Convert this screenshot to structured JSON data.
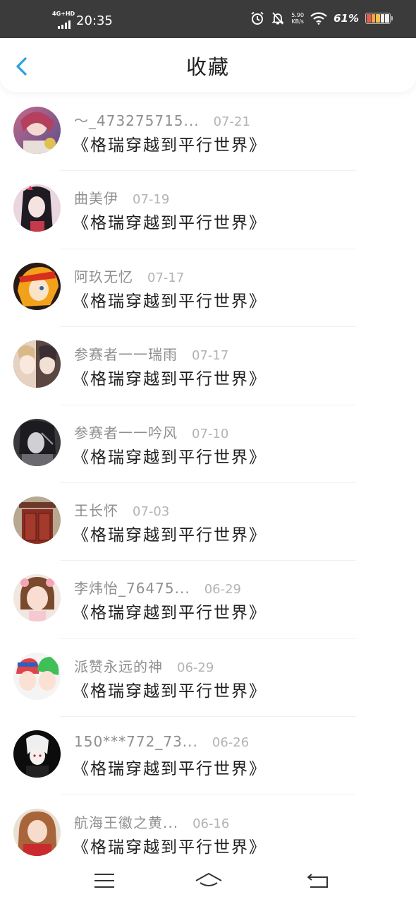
{
  "status_bar": {
    "network_type": "4G+HD",
    "time": "20:35",
    "speed_value": "5.90",
    "speed_unit": "KB/s",
    "battery_percent": "61%",
    "icons": [
      "signal-icon",
      "alarm-icon",
      "notifications-off-icon",
      "wifi-icon",
      "battery-icon"
    ]
  },
  "header": {
    "back_icon": "chevron-left-icon",
    "title": "收藏",
    "accent_color": "#2d9fe0"
  },
  "items": [
    {
      "user": "～_473275715...",
      "date": "07-21",
      "title": "《格瑞穿越到平行世界》",
      "avatar": "anime-avatar-1"
    },
    {
      "user": "曲美伊",
      "date": "07-19",
      "title": "《格瑞穿越到平行世界》",
      "avatar": "anime-avatar-2"
    },
    {
      "user": "阿玖无忆",
      "date": "07-17",
      "title": "《格瑞穿越到平行世界》",
      "avatar": "anime-avatar-3"
    },
    {
      "user": "参赛者一一瑞雨",
      "date": "07-17",
      "title": "《格瑞穿越到平行世界》",
      "avatar": "anime-avatar-4"
    },
    {
      "user": "参赛者一一吟风",
      "date": "07-10",
      "title": "《格瑞穿越到平行世界》",
      "avatar": "anime-avatar-5"
    },
    {
      "user": "王长怀",
      "date": "07-03",
      "title": "《格瑞穿越到平行世界》",
      "avatar": "door-photo-avatar"
    },
    {
      "user": "李炜怡_76475...",
      "date": "06-29",
      "title": "《格瑞穿越到平行世界》",
      "avatar": "girl-photo-avatar"
    },
    {
      "user": "派赞永远的神",
      "date": "06-29",
      "title": "《格瑞穿越到平行世界》",
      "avatar": "anime-avatar-6"
    },
    {
      "user": "150***772_73...",
      "date": "06-26",
      "title": "《格瑞穿越到平行世界》",
      "avatar": "anime-avatar-7"
    },
    {
      "user": "航海王徽之黄...",
      "date": "06-16",
      "title": "《格瑞穿越到平行世界》",
      "avatar": "girl-photo-avatar-2"
    }
  ],
  "nav_bar": {
    "icons": [
      "menu-icon",
      "home-icon",
      "back-icon"
    ]
  }
}
